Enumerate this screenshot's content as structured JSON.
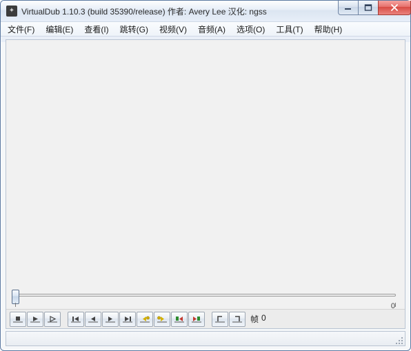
{
  "window": {
    "title": "VirtualDub 1.10.3 (build 35390/release) 作者: Avery Lee  汉化: ngss"
  },
  "menu": {
    "items": [
      {
        "label": "文件(F)"
      },
      {
        "label": "编辑(E)"
      },
      {
        "label": "查看(I)"
      },
      {
        "label": "跳转(G)"
      },
      {
        "label": "视频(V)"
      },
      {
        "label": "音频(A)"
      },
      {
        "label": "选项(O)"
      },
      {
        "label": "工具(T)"
      },
      {
        "label": "帮助(H)"
      }
    ]
  },
  "timeline": {
    "current_frame": 0,
    "end_frame_display": "0"
  },
  "frame_readout": {
    "label": "帧",
    "value": "0"
  },
  "toolbar_buttons": [
    "stop",
    "play-input",
    "play-output",
    "go-start",
    "step-back",
    "step-forward",
    "go-end",
    "prev-keyframe",
    "next-keyframe",
    "prev-scene",
    "next-scene",
    "mark-in",
    "mark-out"
  ]
}
